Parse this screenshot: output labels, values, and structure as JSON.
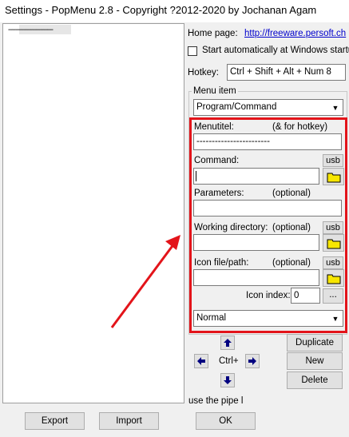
{
  "window": {
    "title": "Settings - PopMenu 2.8 - Copyright ?2012-2020 by Jochanan Agam"
  },
  "tree": {
    "item": "------------------------"
  },
  "home": {
    "label": "Home page:",
    "link": "http://freeware.persoft.ch"
  },
  "startup": {
    "label": "Start automatically at Windows startup",
    "checked": false
  },
  "hotkey": {
    "label": "Hotkey:",
    "value": "Ctrl + Shift + Alt + Num 8"
  },
  "menu_item": {
    "group_title": "Menu item",
    "type_selected": "Program/Command",
    "menutitel_label": "Menutitel:",
    "menutitel_hint": "(& for hotkey)",
    "menutitel_value": "------------------------",
    "command_label": "Command:",
    "command_value": "",
    "parameters_label": "Parameters:",
    "parameters_hint": "(optional)",
    "parameters_value": "",
    "workdir_label": "Working directory:",
    "workdir_hint": "(optional)",
    "workdir_value": "",
    "iconfile_label": "Icon file/path:",
    "iconfile_hint": "(optional)",
    "iconfile_value": "",
    "icon_index_label": "Icon index:",
    "icon_index_value": "0",
    "browse_label": "...",
    "usb_label": "usb",
    "window_state_selected": "Normal"
  },
  "move": {
    "ctrl_label": "Ctrl+"
  },
  "actions": {
    "duplicate": "Duplicate",
    "new": "New",
    "delete": "Delete"
  },
  "footer_hint": "use the pipe l",
  "bottom": {
    "export": "Export",
    "import": "Import",
    "ok": "OK"
  },
  "colors": {
    "highlight_frame": "#e3141a",
    "link": "#0000cc",
    "arrow_icon": "#000080",
    "folder": "#f7e600"
  }
}
